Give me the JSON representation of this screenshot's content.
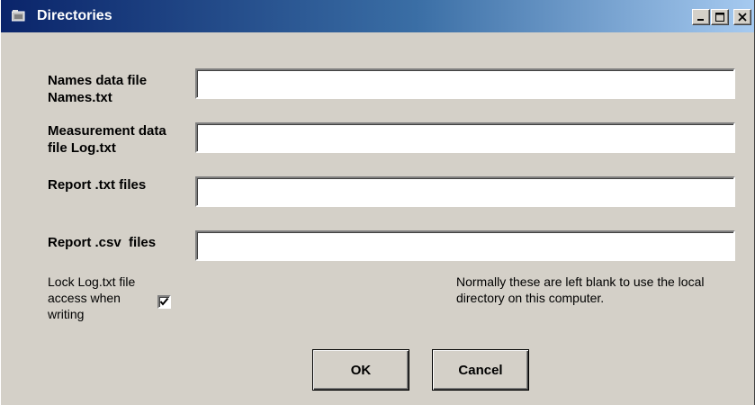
{
  "window": {
    "title": "Directories",
    "icon": "folder-icon",
    "controls": {
      "minimize": "minimize-icon",
      "maximize": "maximize-icon",
      "close": "close-icon"
    },
    "titlebar_colors": [
      "#0a246a",
      "#a6caf0"
    ]
  },
  "fields": [
    {
      "label_line1": "Names data file",
      "label_line2": "Names.txt",
      "value": ""
    },
    {
      "label_line1": "Measurement data",
      "label_line2": "file Log.txt",
      "value": ""
    },
    {
      "label": "Report .txt files",
      "value": ""
    },
    {
      "label": "Report .csv  files",
      "value": ""
    }
  ],
  "lock": {
    "line1": "Lock Log.txt file",
    "line2": "access when",
    "line3": "writing",
    "checked": true
  },
  "note": {
    "line1": "Normally these are left blank to use the local",
    "line2": "directory on this computer."
  },
  "buttons": {
    "ok": "OK",
    "cancel": "Cancel"
  }
}
